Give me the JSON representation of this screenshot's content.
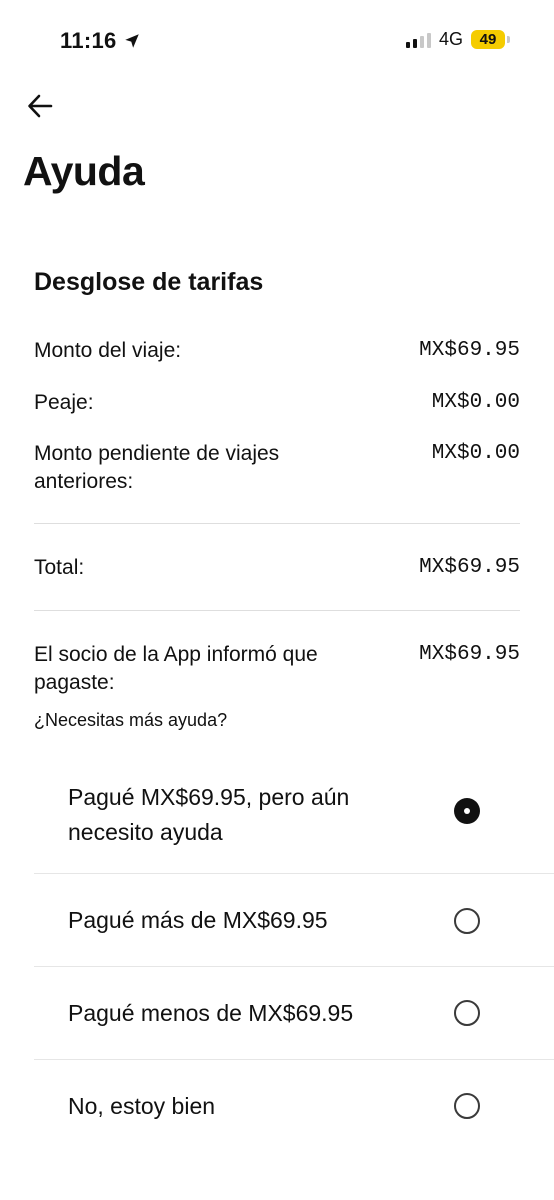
{
  "status_bar": {
    "time": "11:16",
    "network": "4G",
    "battery": "49"
  },
  "header": {
    "title": "Ayuda"
  },
  "fare_breakdown": {
    "title": "Desglose de tarifas",
    "rows": [
      {
        "label": "Monto del viaje:",
        "value": "MX$69.95"
      },
      {
        "label": "Peaje:",
        "value": "MX$0.00"
      },
      {
        "label": "Monto pendiente de viajes anteriores:",
        "value": "MX$0.00"
      }
    ],
    "total": {
      "label": "Total:",
      "value": "MX$69.95"
    },
    "reported": {
      "label": "El socio de la App informó que pagaste:",
      "value": "MX$69.95"
    }
  },
  "help": {
    "question": "¿Necesitas más ayuda?",
    "options": [
      {
        "label": "Pagué MX$69.95, pero aún necesito ayuda",
        "selected": true
      },
      {
        "label": "Pagué más de MX$69.95",
        "selected": false
      },
      {
        "label": "Pagué menos de MX$69.95",
        "selected": false
      },
      {
        "label": "No, estoy bien",
        "selected": false
      }
    ]
  }
}
